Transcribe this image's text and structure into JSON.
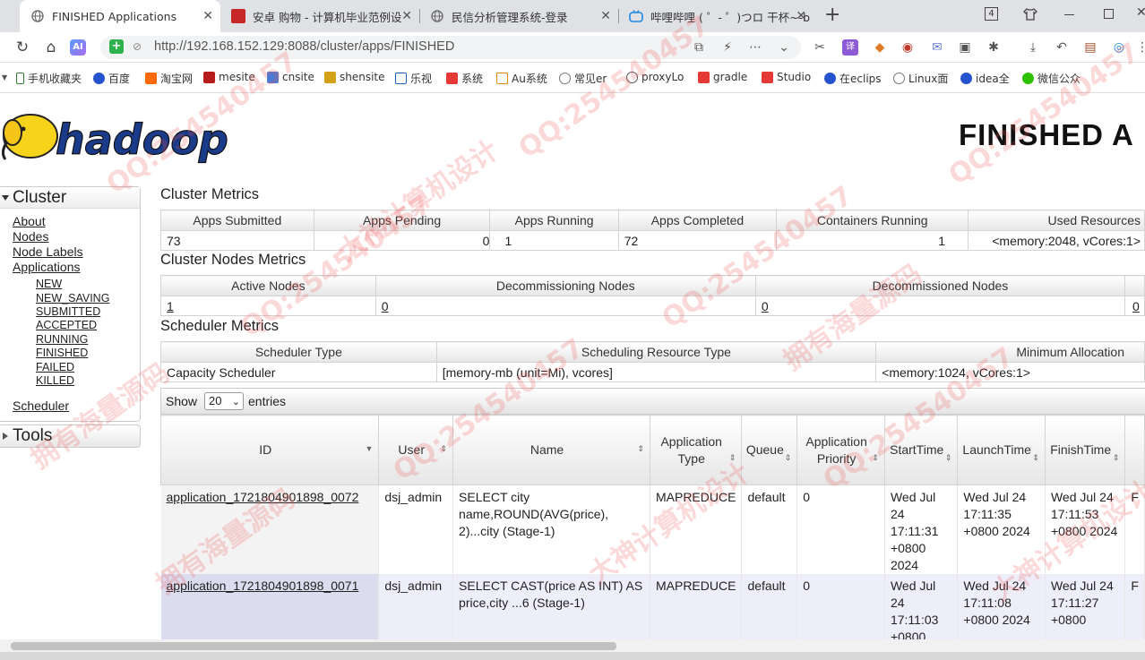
{
  "browser": {
    "tabs": [
      {
        "title": "FINISHED Applications",
        "icon": "globe-icon"
      },
      {
        "title": "安卓 购物 - 计算机毕业范例设",
        "icon": "red-square-icon"
      },
      {
        "title": "民信分析管理系统-登录",
        "icon": "globe-icon"
      },
      {
        "title": "哔哩哔哩 ( ゜- ゜)つロ 干杯~-b",
        "icon": "bilibili-icon"
      }
    ],
    "tab_close": "✕",
    "new_tab": "+",
    "tab_count": "4",
    "url": "http://192.168.152.129:8088/cluster/apps/FINISHED",
    "bookmarks": [
      "手机收藏夹",
      "百度",
      "淘宝网",
      "mesite",
      "cnsite",
      "shensite",
      "乐视",
      "系统",
      "Au系统",
      "常见er",
      "proxyLo",
      "gradle",
      "Studio",
      "在eclips",
      "Linux面",
      "idea全",
      "微信公众"
    ]
  },
  "logo_text": "hadoop",
  "page_title": "FINISHED A",
  "nav": {
    "cluster_header": "Cluster",
    "links": [
      "About",
      "Nodes",
      "Node Labels",
      "Applications"
    ],
    "sublinks": [
      "NEW",
      "NEW_SAVING",
      "SUBMITTED",
      "ACCEPTED",
      "RUNNING",
      "FINISHED",
      "FAILED",
      "KILLED"
    ],
    "scheduler": "Scheduler",
    "tools_header": "Tools"
  },
  "cluster_metrics": {
    "title": "Cluster Metrics",
    "headers": [
      "Apps Submitted",
      "Apps Pending",
      "Apps Running",
      "Apps Completed",
      "Containers Running",
      "Used Resources"
    ],
    "values": [
      "73",
      "0",
      "1",
      "72",
      "1",
      "<memory:2048, vCores:1>"
    ]
  },
  "cluster_nodes_metrics": {
    "title": "Cluster Nodes Metrics",
    "headers": [
      "Active Nodes",
      "Decommissioning Nodes",
      "Decommissioned Nodes"
    ],
    "values": [
      "1",
      "0",
      "0",
      "0"
    ]
  },
  "scheduler_metrics": {
    "title": "Scheduler Metrics",
    "headers": [
      "Scheduler Type",
      "Scheduling Resource Type",
      "Minimum Allocation"
    ],
    "values": [
      "Capacity Scheduler",
      "[memory-mb (unit=Mi), vcores]",
      "<memory:1024, vCores:1>"
    ]
  },
  "apps_table": {
    "show_label": "Show",
    "entries_value": "20",
    "entries_label": "entries",
    "headers": [
      "ID",
      "User",
      "Name",
      "Application Type",
      "Queue",
      "Application Priority",
      "StartTime",
      "LaunchTime",
      "FinishTime",
      "F"
    ],
    "rows": [
      {
        "id": "application_1721804901898_0072",
        "user": "dsj_admin",
        "name": "SELECT city name,ROUND(AVG(price), 2)...city (Stage-1)",
        "type": "MAPREDUCE",
        "queue": "default",
        "priority": "0",
        "start": "Wed Jul 24 17:11:31 +0800 2024",
        "launch": "Wed Jul 24 17:11:35 +0800 2024",
        "finish": "Wed Jul 24 17:11:53 +0800 2024",
        "extra": "F"
      },
      {
        "id": "application_1721804901898_0071",
        "user": "dsj_admin",
        "name": "SELECT CAST(price AS INT) AS price,city ...6 (Stage-1)",
        "type": "MAPREDUCE",
        "queue": "default",
        "priority": "0",
        "start": "Wed Jul 24 17:11:03 +0800",
        "launch": "Wed Jul 24 17:11:08 +0800 2024",
        "finish": "Wed Jul 24 17:11:27 +0800",
        "extra": "F"
      }
    ]
  },
  "watermarks": [
    "QQ:254540457",
    "拥有海量源码",
    "大神计算机设计"
  ]
}
